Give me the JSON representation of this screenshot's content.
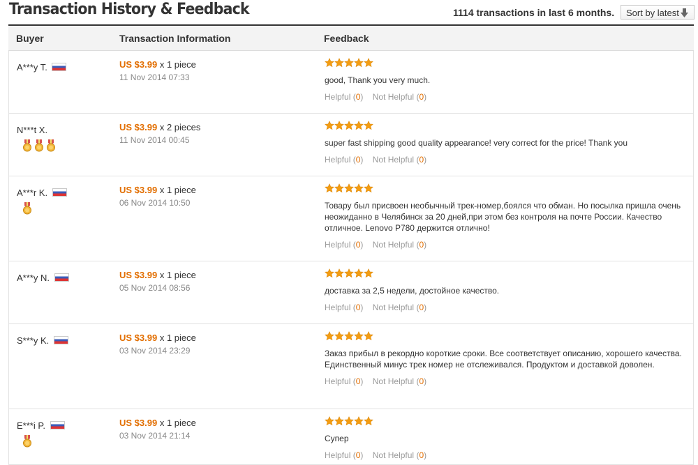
{
  "header": {
    "title": "Transaction History & Feedback",
    "summary": "1114 transactions in last 6 months.",
    "sort_label": "Sort by latest"
  },
  "columns": {
    "buyer": "Buyer",
    "transaction": "Transaction Information",
    "feedback": "Feedback"
  },
  "colors": {
    "price": "#e26e00",
    "star": "#f39c12",
    "muted": "#999999"
  },
  "rows": [
    {
      "buyer": "A***y T.",
      "flag": "ru",
      "medals": 0,
      "price": "US $3.99",
      "qty": "x 1 piece",
      "date": "11 Nov 2014 07:33",
      "stars": 5,
      "text": "good, Thank you very much.",
      "helpful_label": "Helpful",
      "helpful_count": "0",
      "not_helpful_label": "Not Helpful",
      "not_helpful_count": "0"
    },
    {
      "buyer": "N***t X.",
      "flag": "",
      "medals": 3,
      "price": "US $3.99",
      "qty": "x 2 pieces",
      "date": "11 Nov 2014 00:45",
      "stars": 5,
      "text": "super fast shipping good quality appearance! very correct for the price! Thank you",
      "helpful_label": "Helpful",
      "helpful_count": "0",
      "not_helpful_label": "Not Helpful",
      "not_helpful_count": "0"
    },
    {
      "buyer": "A***r K.",
      "flag": "ru",
      "medals": 1,
      "price": "US $3.99",
      "qty": "x 1 piece",
      "date": "06 Nov 2014 10:50",
      "stars": 5,
      "text": "Товару был присвоен необычный трек-номер,боялся что обман. Но посылка пришла очень неожиданно в Челябинск за 20 дней,при этом без контроля на почте России. Качество отличное. Lenovo P780 держится отлично!",
      "helpful_label": "Helpful",
      "helpful_count": "0",
      "not_helpful_label": "Not Helpful",
      "not_helpful_count": "0"
    },
    {
      "buyer": "A***y N.",
      "flag": "ru",
      "medals": 0,
      "price": "US $3.99",
      "qty": "x 1 piece",
      "date": "05 Nov 2014 08:56",
      "stars": 5,
      "text": "доставка за 2,5 недели, достойное качество.",
      "helpful_label": "Helpful",
      "helpful_count": "0",
      "not_helpful_label": "Not Helpful",
      "not_helpful_count": "0"
    },
    {
      "buyer": "S***y K.",
      "flag": "ru",
      "medals": 0,
      "price": "US $3.99",
      "qty": "x 1 piece",
      "date": "03 Nov 2014 23:29",
      "stars": 5,
      "text": "Заказ прибыл в рекордно короткие сроки. Все соответствует описанию, хорошего качества. Единственный минус трек номер не отслеживался. Продуктом и доставкой доволен.",
      "helpful_label": "Helpful",
      "helpful_count": "0",
      "not_helpful_label": "Not Helpful",
      "not_helpful_count": "0"
    },
    {
      "buyer": "E***i P.",
      "flag": "ru",
      "medals": 1,
      "price": "US $3.99",
      "qty": "x 1 piece",
      "date": "03 Nov 2014 21:14",
      "stars": 5,
      "text": "Супер",
      "helpful_label": "Helpful",
      "helpful_count": "0",
      "not_helpful_label": "Not Helpful",
      "not_helpful_count": "0"
    }
  ]
}
